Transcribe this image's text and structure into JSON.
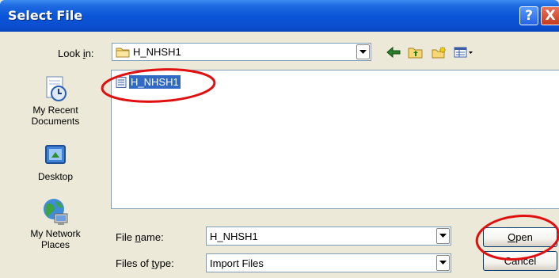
{
  "window": {
    "title": "Select File",
    "help_glyph": "?",
    "close_glyph": "X"
  },
  "lookin": {
    "label_pre": "Look ",
    "label_access": "i",
    "label_post": "n:",
    "value": "H_NHSH1"
  },
  "places": [
    {
      "label": "My Recent Documents",
      "icon": "recent-documents-icon"
    },
    {
      "label": "Desktop",
      "icon": "desktop-icon"
    },
    {
      "label": "My Network Places",
      "icon": "network-places-icon"
    }
  ],
  "files": [
    {
      "name": "H_NHSH1",
      "selected": true,
      "icon": "document-icon"
    }
  ],
  "filename": {
    "label_pre": "File ",
    "label_access": "n",
    "label_post": "ame:",
    "value": "H_NHSH1"
  },
  "filetype": {
    "label_pre": "Files of ",
    "label_access": "t",
    "label_post": "ype:",
    "value": "Import Files"
  },
  "buttons": {
    "open_access": "O",
    "open_rest": "pen",
    "cancel": "Cancel"
  },
  "colors": {
    "titlebar": "#0a55d9",
    "dialog_bg": "#ece9d8",
    "selection": "#316ac5",
    "annotation": "#e01010"
  }
}
